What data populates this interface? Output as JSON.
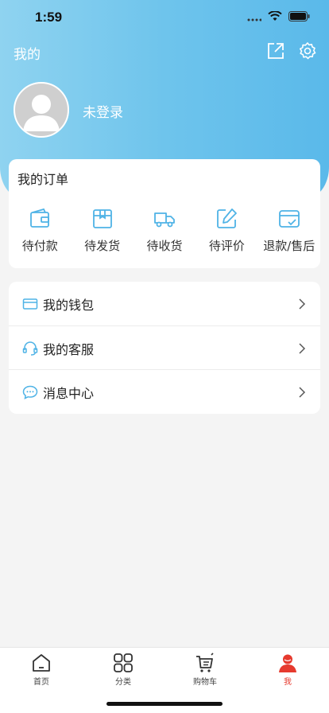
{
  "status": {
    "time": "1:59"
  },
  "header": {
    "title": "我的",
    "login_text": "未登录"
  },
  "orders": {
    "title": "我的订单",
    "items": [
      {
        "label": "待付款",
        "icon": "wallet-icon"
      },
      {
        "label": "待发货",
        "icon": "package-icon"
      },
      {
        "label": "待收货",
        "icon": "truck-icon"
      },
      {
        "label": "待评价",
        "icon": "edit-icon"
      },
      {
        "label": "退款/售后",
        "icon": "refund-icon"
      }
    ]
  },
  "menu": [
    {
      "label": "我的钱包",
      "icon": "card-icon"
    },
    {
      "label": "我的客服",
      "icon": "headset-icon"
    },
    {
      "label": "消息中心",
      "icon": "chat-icon"
    }
  ],
  "tabs": [
    {
      "label": "首页",
      "icon": "home-icon",
      "active": false
    },
    {
      "label": "分类",
      "icon": "category-icon",
      "active": false
    },
    {
      "label": "购物车",
      "icon": "cart-icon",
      "active": false
    },
    {
      "label": "我",
      "icon": "user-icon",
      "active": true
    }
  ],
  "colors": {
    "accent": "#5ab9ea",
    "icon_blue": "#4fb3e6",
    "active_tab": "#e63a2e"
  }
}
